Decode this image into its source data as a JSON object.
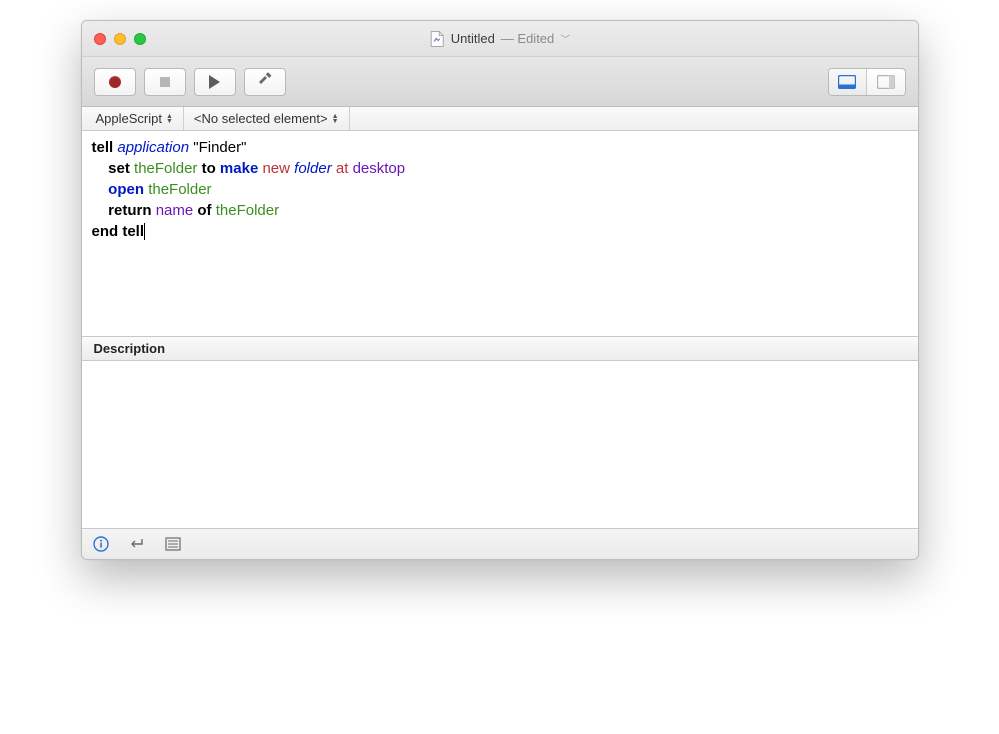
{
  "title": {
    "name": "Untitled",
    "edited": "— Edited"
  },
  "nav": {
    "language": "AppleScript",
    "selector": "<No selected element>"
  },
  "code": {
    "l1_tell": "tell",
    "l1_app": "application",
    "l1_target": "\"Finder\"",
    "l2_set": "set",
    "l2_var1": "theFolder",
    "l2_to": "to",
    "l2_make": "make",
    "l2_new": "new",
    "l2_folder": "folder",
    "l2_at": "at",
    "l2_desktop": "desktop",
    "l3_open": "open",
    "l3_var": "theFolder",
    "l4_return": "return",
    "l4_name": "name",
    "l4_of": "of",
    "l4_var": "theFolder",
    "l5": "end tell"
  },
  "description": {
    "label": "Description"
  }
}
